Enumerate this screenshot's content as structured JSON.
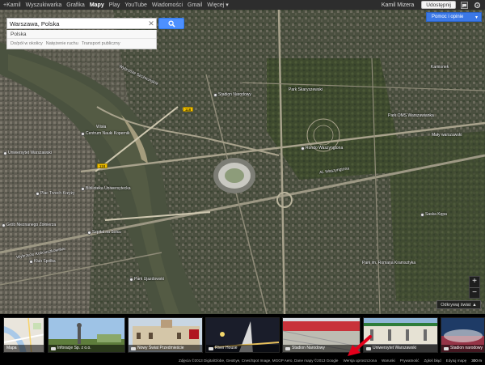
{
  "gbar": {
    "items": [
      {
        "label": "+Kamil",
        "active": false
      },
      {
        "label": "Wyszukiwarka",
        "active": false
      },
      {
        "label": "Grafika",
        "active": false
      },
      {
        "label": "Mapy",
        "active": true
      },
      {
        "label": "Play",
        "active": false
      },
      {
        "label": "YouTube",
        "active": false
      },
      {
        "label": "Wiadomości",
        "active": false
      },
      {
        "label": "Gmail",
        "active": false
      },
      {
        "label": "Więcej ▾",
        "active": false
      }
    ],
    "user_name": "Kamil Mizera",
    "share_label": "Udostępnij",
    "icons": [
      "notification-icon",
      "settings-gear-icon"
    ]
  },
  "search": {
    "value": "Warszawa, Polska",
    "clear_symbol": "✕",
    "button_icon": "search-icon"
  },
  "place_card": {
    "title": "Polska",
    "links": [
      "Do/pół w okolicy",
      "Natężenie ruchu",
      "Transport publiczny"
    ]
  },
  "help": {
    "label": "Pomoc i opinie",
    "caret": "▾"
  },
  "zoom": {
    "plus": "+",
    "minus": "−"
  },
  "discover": {
    "label": "Odkrywaj świat",
    "caret": "▲"
  },
  "map_labels": {
    "districts": [
      "Kamionek",
      "Saska Kępa",
      "Park im. Romana Kramsztyka",
      "Park OMS Warszawianka",
      "Mały warszawski",
      "Park Skaryszewski",
      "Al. Waszyngtona",
      "Wisła",
      "Wybrzeże Kościuszkowskie",
      "Wybrzeże Szczecińskie"
    ],
    "pois": [
      "Stadion Narodowy",
      "Centrum Nauki Kopernik",
      "Biblioteka Uniwersytecka",
      "Szpital na Solcu",
      "Uniwersytet Warszawski",
      "Grób Nieznanego Żołnierza",
      "Rondo Waszyngtona",
      "Klub Spółka",
      "Park Ujazdowski",
      "Saska Kępa",
      "Plac Trzech Krzyży"
    ],
    "road_badges": [
      "118",
      "118"
    ]
  },
  "filmstrip": [
    {
      "caption": "Mapa",
      "kind": "map"
    },
    {
      "caption": "Inforacje Sp. z o.o.",
      "kind": "photo"
    },
    {
      "caption": "Nowy Świat Przedmieście",
      "kind": "photo"
    },
    {
      "caption": "River House",
      "kind": "photo"
    },
    {
      "caption": "Stadion Narodowy",
      "kind": "photo"
    },
    {
      "caption": "Uniwersytet Warszawski",
      "kind": "photo"
    },
    {
      "caption": "Stadion narodowy",
      "kind": "photo"
    }
  ],
  "footer": {
    "items": [
      "Zdjęcia ©2013 DigitalGlobe, GeoEye, Cnes/Spot Image, MGGP Aero, Dane mapy ©2013 Google",
      "Wersja uproszczona",
      "Warunki",
      "Prywatność",
      "Zgłoś błąd",
      "Edytuj mapę"
    ],
    "scale": "300 m"
  },
  "colors": {
    "accent_blue": "#4d90fe",
    "highlight_red": "#e3001b",
    "stadium_red": "#c8323a"
  }
}
